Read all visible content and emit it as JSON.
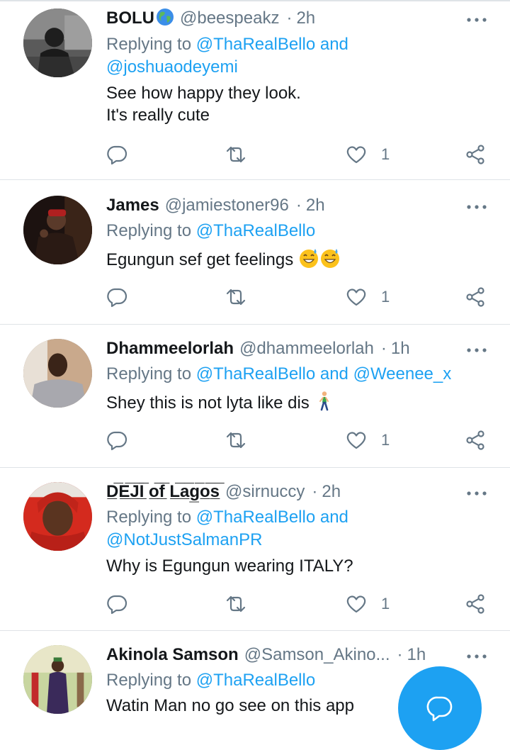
{
  "tweets": [
    {
      "name": "BOLU",
      "handle": "@beespeakz",
      "time": "2h",
      "reply_prefix": "Replying to ",
      "reply_line1": "@ThaRealBello and",
      "reply_line2": "@joshuaodeyemi",
      "text_line1": "See how happy they look.",
      "text_line2": "It's really cute",
      "likes": "1"
    },
    {
      "name": "James",
      "handle": "@jamiestoner96",
      "time": "2h",
      "reply_prefix": "Replying to ",
      "reply_line1": "@ThaRealBello",
      "text_line1": "Egungun sef get feelings",
      "likes": "1"
    },
    {
      "name": "Dhammeelorlah",
      "handle": "@dhammeelorlah",
      "time": "1h",
      "reply_prefix": "Replying to ",
      "reply_line1": "@ThaRealBello and @Weenee_x",
      "text_line1": "Shey this is not lyta like dis",
      "likes": "1"
    },
    {
      "name": "D̲̅E̲̅J̲̅I̲̅ o̲̅f̲̅ L̲̅a̲̅g̲̅o̲̅s̲̅",
      "handle": "@sirnuccy",
      "time": "2h",
      "reply_prefix": "Replying to ",
      "reply_line1": "@ThaRealBello and",
      "reply_line2": "@NotJustSalmanPR",
      "text_line1": "Why is Egungun wearing ITALY?",
      "likes": "1"
    },
    {
      "name": "Akinola Samson",
      "handle": "@Samson_Akino...",
      "time": "1h",
      "reply_prefix": "Replying to ",
      "reply_line1": "@ThaRealBello",
      "text_line1": "Watin Man no go see on this app"
    }
  ],
  "icons": {
    "reply": "reply-icon",
    "retweet": "retweet-icon",
    "like": "heart-icon",
    "share": "share-icon",
    "more": "more-icon",
    "compose": "compose-reply-icon"
  },
  "colors": {
    "accent": "#1da1f2",
    "secondary_text": "#657786",
    "divider": "#dfe3e7"
  }
}
